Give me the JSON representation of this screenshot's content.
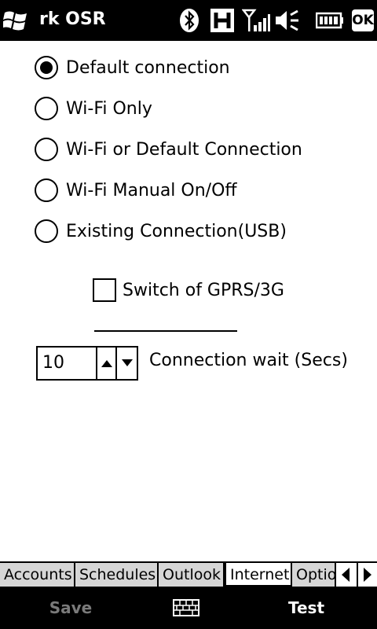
{
  "titlebar": {
    "app_title": "rk OSR",
    "icons": [
      "windows-start-icon",
      "bluetooth-icon",
      "hsdpa-h-icon",
      "signal-strength-icon",
      "volume-icon",
      "battery-icon"
    ],
    "ok_label": "OK"
  },
  "connection": {
    "options": [
      {
        "label": "Default connection",
        "selected": true
      },
      {
        "label": "Wi-Fi Only",
        "selected": false
      },
      {
        "label": "Wi-Fi or Default Connection",
        "selected": false
      },
      {
        "label": "Wi-Fi Manual On/Off",
        "selected": false
      },
      {
        "label": "Existing Connection(USB)",
        "selected": false
      }
    ],
    "switch_off_gprs_label": "Switch of GPRS/3G",
    "switch_off_gprs_checked": false,
    "wait_value": "10",
    "wait_label": "Connection wait (Secs)"
  },
  "tabs": [
    {
      "label": "Accounts",
      "active": false
    },
    {
      "label": "Schedules",
      "active": false
    },
    {
      "label": "Outlook",
      "active": false
    },
    {
      "label": "Internet",
      "active": true
    },
    {
      "label": "Optio",
      "active": false
    }
  ],
  "softkeys": {
    "left": "Save",
    "left_enabled": false,
    "center_icon": "keyboard-icon",
    "right": "Test"
  },
  "colors": {
    "bar_background": "#000000",
    "tab_inactive": "#d6d6d6",
    "disabled_text": "#7a7a7a"
  }
}
